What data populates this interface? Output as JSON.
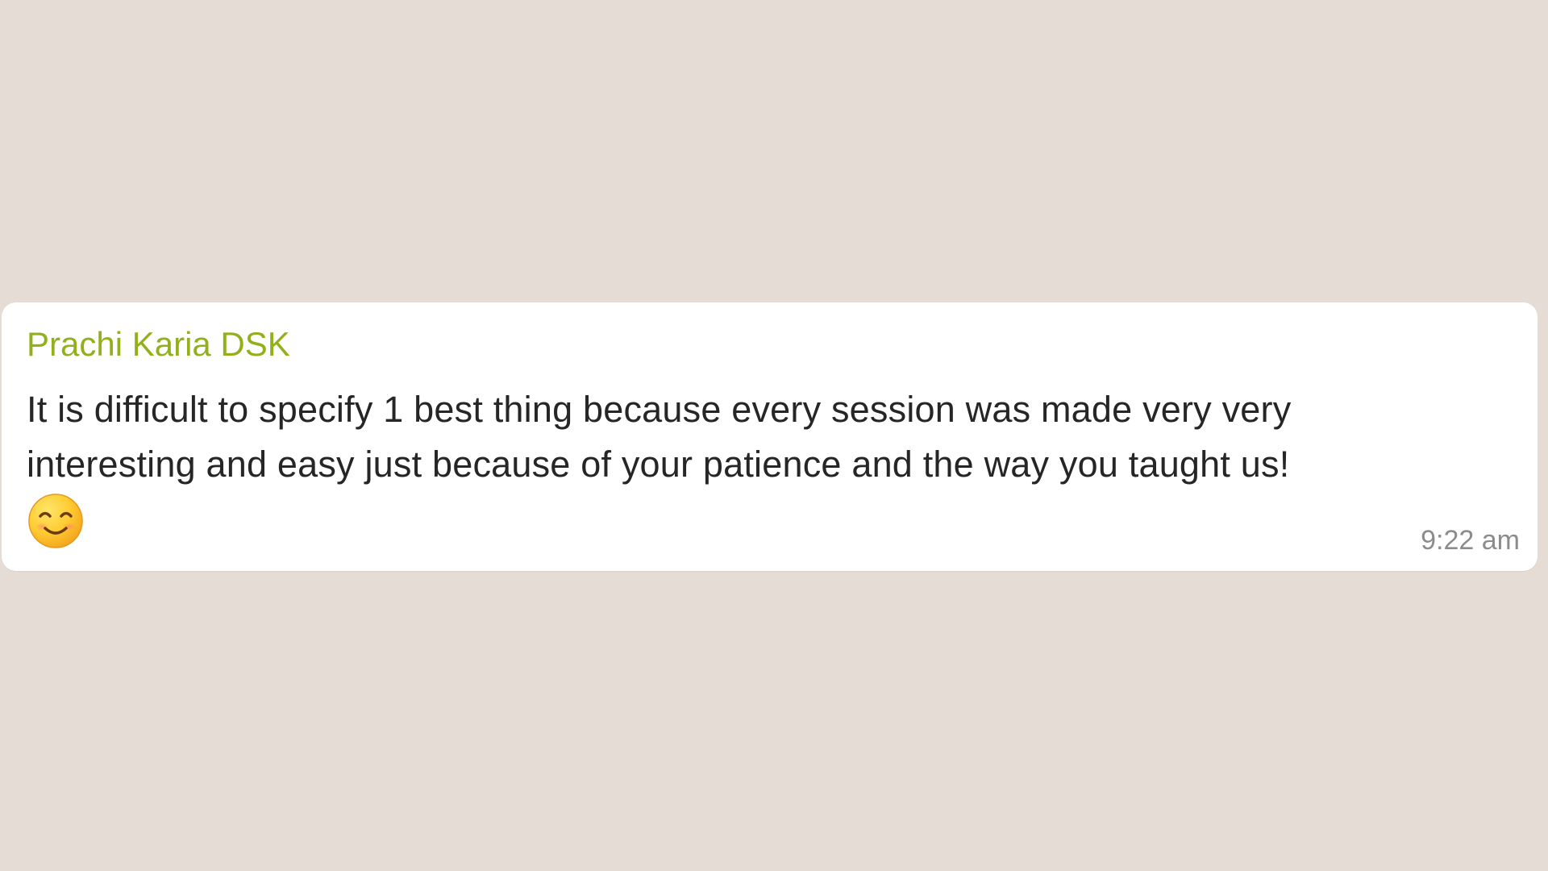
{
  "message": {
    "sender": "Prachi Karia DSK",
    "lines": [
      "It is difficult to specify 1 best thing because every session was made very very",
      "interesting and easy just because of your patience and the way you taught us!"
    ],
    "emoji": "smiling-face-with-smiling-eyes-icon",
    "time": "9:22 am"
  },
  "colors": {
    "chat_background": "#e5ddd5",
    "bubble_background": "#ffffff",
    "sender_name": "#92b01a",
    "message_text": "#262626",
    "timestamp": "#8c8c8c"
  }
}
